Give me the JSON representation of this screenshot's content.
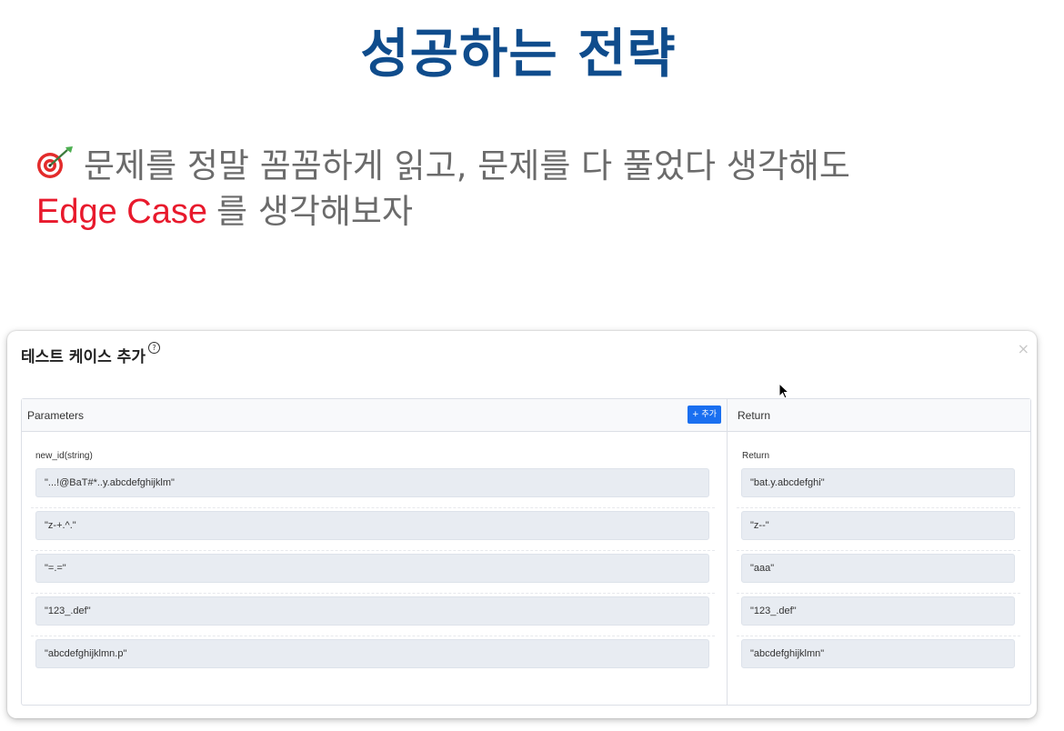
{
  "slide": {
    "title": "성공하는 전략",
    "tip_line1": "문제를 정말 꼼꼼하게 읽고, 문제를 다 풀었다 생각해도",
    "tip_highlight": "Edge Case",
    "tip_line2_rest": "를 생각해보자",
    "tip_icon": "dart-target-icon",
    "colors": {
      "title": "#0f4c8c",
      "highlight": "#e8192c",
      "body_text": "#6b6b6b"
    }
  },
  "modal": {
    "title": "테스트 케이스 추가",
    "help_symbol": "?",
    "close_symbol": "×",
    "parameters": {
      "header": "Parameters",
      "add_button": "+ 추가",
      "field_label": "new_id(string)",
      "values": [
        "\"...!@BaT#*..y.abcdefghijklm\"",
        "\"z-+.^.\"",
        "\"=.=\"",
        "\"123_.def\"",
        "\"abcdefghijklmn.p\""
      ]
    },
    "return": {
      "header": "Return",
      "field_label": "Return",
      "values": [
        "\"bat.y.abcdefghi\"",
        "\"z--\"",
        "\"aaa\"",
        "\"123_.def\"",
        "\"abcdefghijklmn\""
      ]
    },
    "accent_color": "#1a6ff0"
  }
}
